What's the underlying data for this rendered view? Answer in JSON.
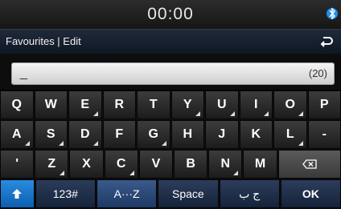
{
  "status": {
    "time": "00:00"
  },
  "header": {
    "title": "Favourites | Edit"
  },
  "input": {
    "cursor": "_",
    "counter": "(20)"
  },
  "keyboard": {
    "row1": [
      "Q",
      "W",
      "E",
      "R",
      "T",
      "Y",
      "U",
      "I",
      "O",
      "P"
    ],
    "row2": [
      "A",
      "S",
      "D",
      "F",
      "G",
      "H",
      "J",
      "K",
      "L",
      "-"
    ],
    "row3": [
      "'",
      "Z",
      "X",
      "C",
      "V",
      "B",
      "N",
      "M"
    ],
    "bottom": {
      "numbers": "123#",
      "alpha": "A···Z",
      "space": "Space",
      "lang": "ج ب",
      "ok": "OK"
    }
  },
  "icons": {
    "status_right": "bluetooth-icon",
    "back": "back-icon",
    "backspace": "backspace-icon",
    "shift": "shift-icon"
  },
  "colors": {
    "shift_key": "#1a78d0",
    "status_bt": "#2aa0ff"
  }
}
